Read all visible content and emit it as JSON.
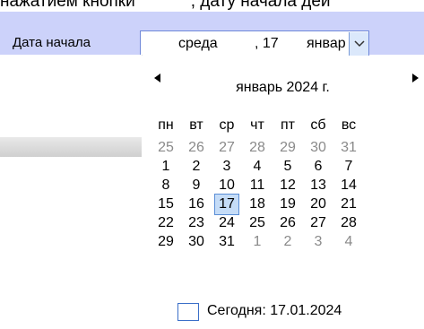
{
  "top_text": {
    "left": "нажатием кнопки",
    "right": ", дату начала дей"
  },
  "field": {
    "label": "Дата начала",
    "weekday": "среда",
    "separator": ", 17",
    "month": "январ",
    "dropdown_icon": "chevron-down-icon"
  },
  "calendar": {
    "title": "январь 2024 г.",
    "prev_icon": "triangle-left-icon",
    "next_icon": "triangle-right-icon",
    "weekdays": [
      "пн",
      "вт",
      "ср",
      "чт",
      "пт",
      "сб",
      "вс"
    ],
    "weeks": [
      [
        "25",
        "26",
        "27",
        "28",
        "29",
        "30",
        "31"
      ],
      [
        "1",
        "2",
        "3",
        "4",
        "5",
        "6",
        "7"
      ],
      [
        "8",
        "9",
        "10",
        "11",
        "12",
        "13",
        "14"
      ],
      [
        "15",
        "16",
        "17",
        "18",
        "19",
        "20",
        "21"
      ],
      [
        "22",
        "23",
        "24",
        "25",
        "26",
        "27",
        "28"
      ],
      [
        "29",
        "30",
        "31",
        "1",
        "2",
        "3",
        "4"
      ]
    ],
    "selected_day": "17",
    "today_label": "Сегодня: 17.01.2024"
  },
  "colors": {
    "band": "#ccd2fa",
    "selected_fill": "#c5dcf7",
    "selected_border": "#5a8ed6",
    "dim_text": "#8a8a8a"
  }
}
